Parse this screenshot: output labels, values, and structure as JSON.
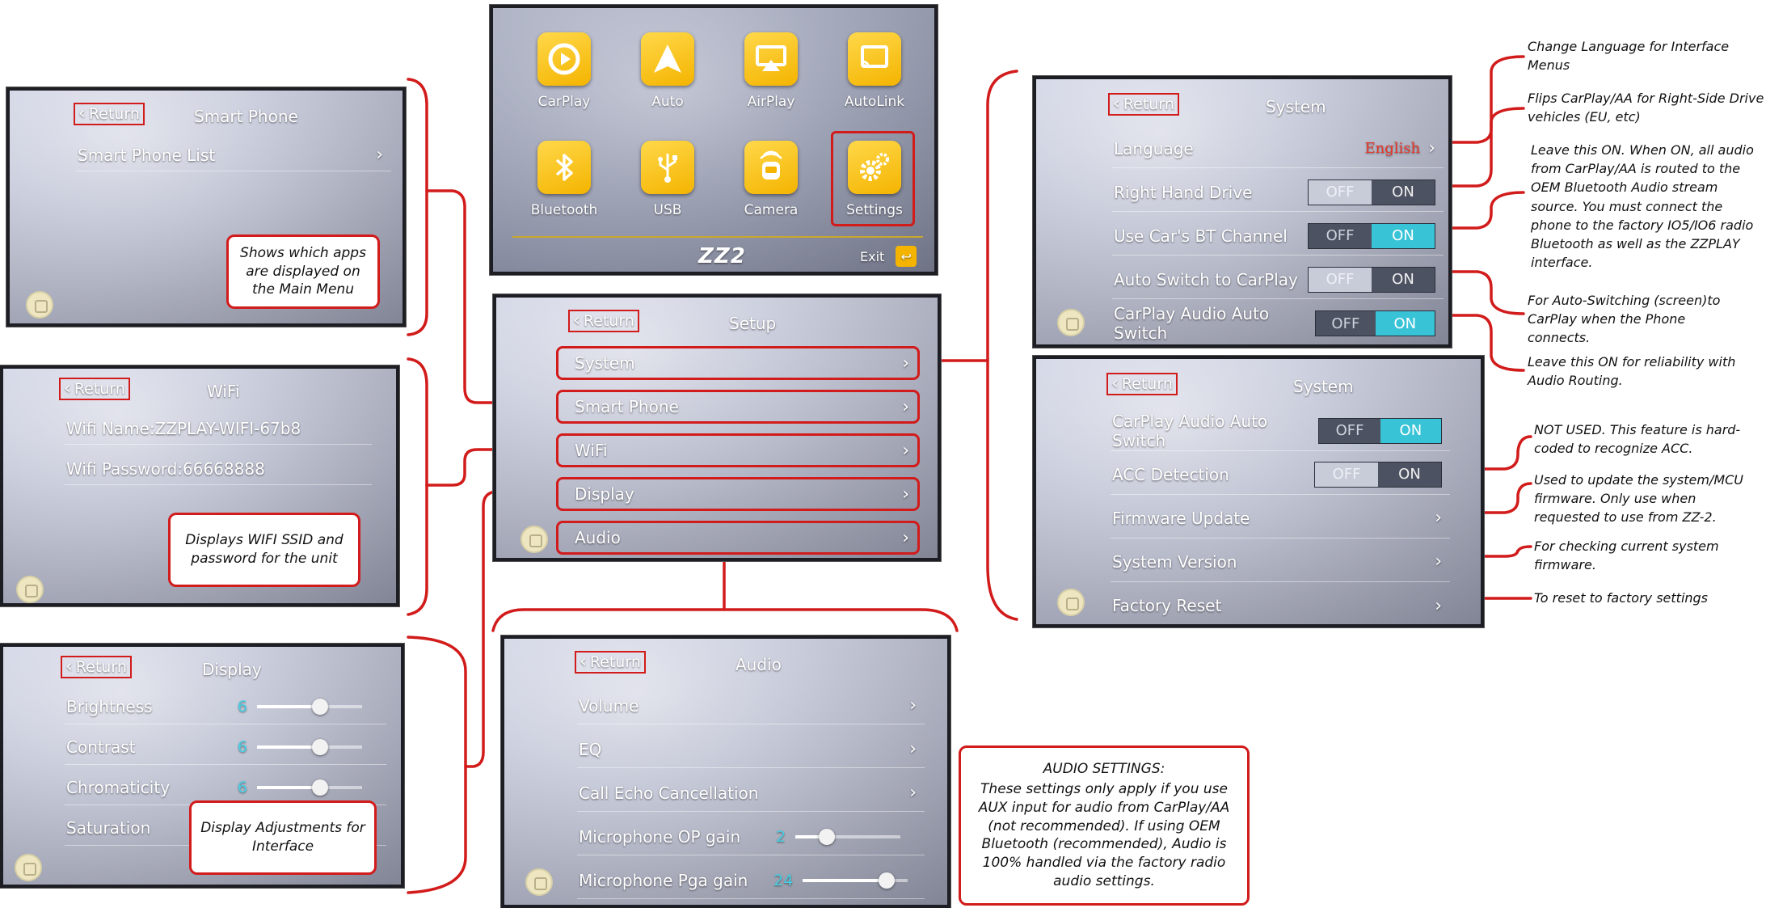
{
  "colors": {
    "accent_red": "#d21b1b",
    "toggle_on": "#38c3d7",
    "app_tile": "#f4b400",
    "slider_value": "#47d0e6",
    "language_value": "#e8382c"
  },
  "main_menu": {
    "apps": [
      {
        "label": "CarPlay",
        "icon": "carplay-icon"
      },
      {
        "label": "Auto",
        "icon": "android-auto-icon"
      },
      {
        "label": "AirPlay",
        "icon": "airplay-icon"
      },
      {
        "label": "AutoLink",
        "icon": "autolink-icon"
      },
      {
        "label": "Bluetooth",
        "icon": "bluetooth-icon"
      },
      {
        "label": "USB",
        "icon": "usb-icon"
      },
      {
        "label": "Camera",
        "icon": "camera-icon"
      },
      {
        "label": "Settings",
        "icon": "gear-icon"
      }
    ],
    "logo": "ZZ2",
    "exit_label": "Exit"
  },
  "setup": {
    "return_label": "Return",
    "title": "Setup",
    "items": [
      "System",
      "Smart Phone",
      "WiFi",
      "Display",
      "Audio"
    ]
  },
  "smart_phone": {
    "return_label": "Return",
    "title": "Smart Phone",
    "list_label": "Smart Phone List",
    "callout": "Shows which apps are displayed on the Main Menu"
  },
  "wifi": {
    "return_label": "Return",
    "title": "WiFi",
    "name": "Wifi Name:ZZPLAY-WIFI-67b8",
    "password": "Wifi Password:66668888",
    "callout": "Displays WIFI SSID and password for the unit"
  },
  "display": {
    "return_label": "Return",
    "title": "Display",
    "rows": [
      {
        "label": "Brightness",
        "value": "6",
        "level": 0.6
      },
      {
        "label": "Contrast",
        "value": "6",
        "level": 0.6
      },
      {
        "label": "Chromaticity",
        "value": "6",
        "level": 0.6
      },
      {
        "label": "Saturation",
        "value": "",
        "level": 0
      }
    ],
    "callout": "Display Adjustments for Interface"
  },
  "audio": {
    "return_label": "Return",
    "title": "Audio",
    "items": [
      "Volume",
      "EQ",
      "Call Echo Cancellation"
    ],
    "mic_op": {
      "label": "Microphone OP gain",
      "value": "2",
      "level": 0.3
    },
    "mic_pga": {
      "label": "Microphone Pga gain",
      "value": "24",
      "level": 0.8
    },
    "callout_heading": "AUDIO SETTINGS:",
    "callout_text": "These settings only apply if you use AUX input for audio from CarPlay/AA (not recommended). If using OEM Bluetooth (recommended), Audio is 100% handled via the factory radio audio settings."
  },
  "system1": {
    "return_label": "Return",
    "title": "System",
    "language_label": "Language",
    "language_value": "English",
    "toggles": [
      {
        "label": "Right Hand Drive",
        "off": "OFF",
        "on": "ON",
        "state": "off"
      },
      {
        "label": "Use Car's BT Channel",
        "off": "OFF",
        "on": "ON",
        "state": "on"
      },
      {
        "label": "Auto Switch to CarPlay",
        "off": "OFF",
        "on": "ON",
        "state": "off"
      },
      {
        "label": "CarPlay Audio Auto Switch",
        "off": "OFF",
        "on": "ON",
        "state": "on"
      }
    ]
  },
  "system2": {
    "return_label": "Return",
    "title": "System",
    "toggles": [
      {
        "label": "CarPlay Audio Auto Switch",
        "off": "OFF",
        "on": "ON",
        "state": "on"
      },
      {
        "label": "ACC Detection",
        "off": "OFF",
        "on": "ON",
        "state": "off"
      }
    ],
    "items": [
      "Firmware Update",
      "System Version",
      "Factory Reset"
    ]
  },
  "notes": {
    "language": "Change Language for Interface Menus",
    "rhd": "Flips CarPlay/AA for Right-Side Drive vehicles (EU, etc)",
    "bt_channel": "Leave this ON. When ON, all audio from CarPlay/AA is routed to the OEM Bluetooth Audio stream source. You must connect the phone to the factory IO5/IO6 radio Bluetooth as well as the ZZPLAY interface.",
    "auto_switch": "For Auto-Switching (screen)to CarPlay when the Phone connects.",
    "audio_auto": "Leave this ON for reliability with Audio Routing.",
    "acc": "NOT USED. This feature is hard-coded to recognize ACC.",
    "firmware": "Used to update the system/MCU firmware. Only use when requested to use from ZZ-2.",
    "version": "For checking current system firmware.",
    "reset": "To reset to factory settings"
  }
}
